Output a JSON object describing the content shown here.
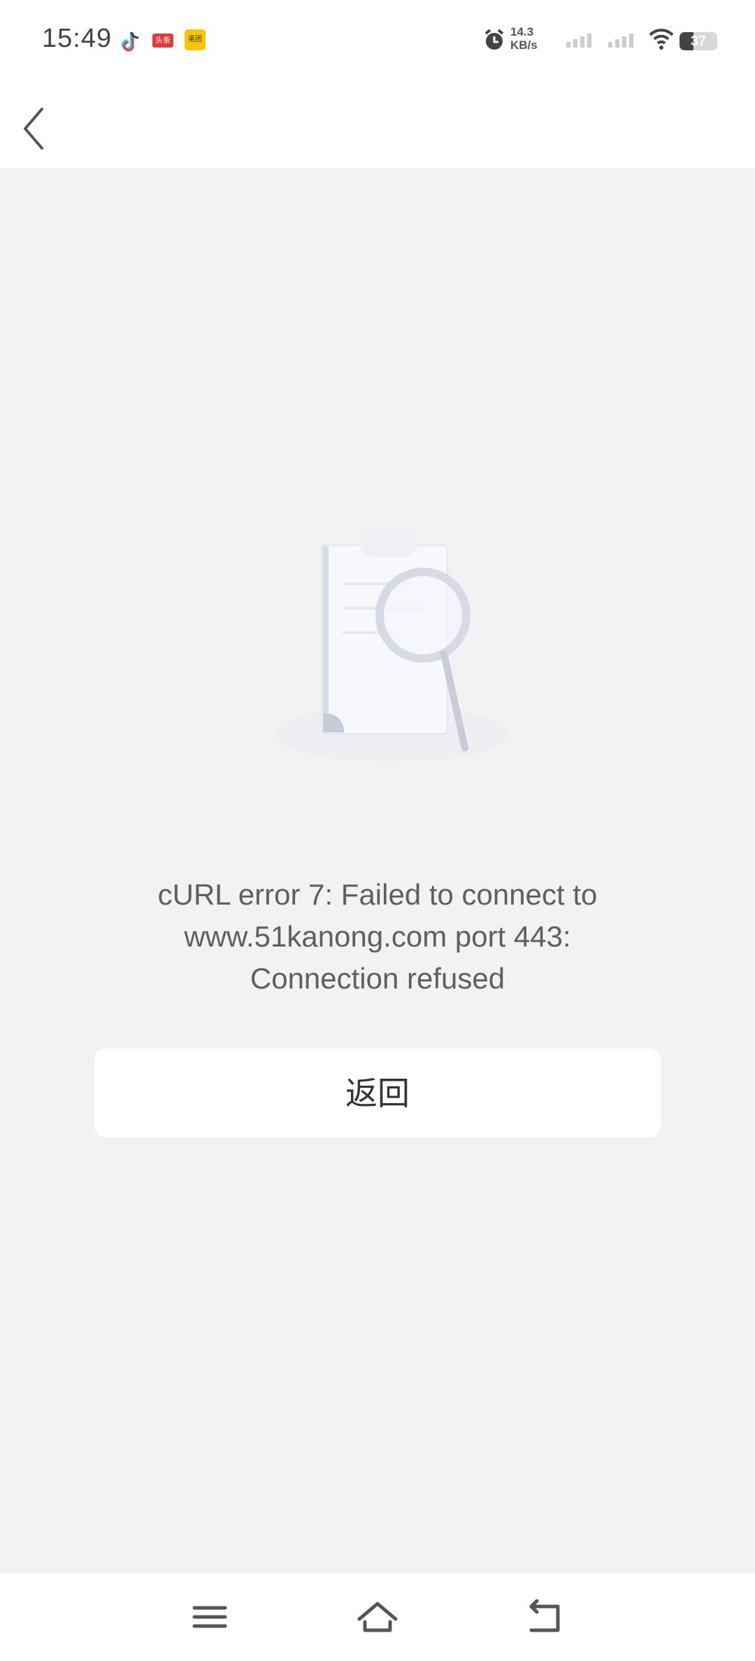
{
  "status_bar": {
    "time": "15:49",
    "notifications": [
      "tiktok-icon",
      "toutiao-icon",
      "meituan-icon"
    ],
    "toutiao_label": "头条",
    "meituan_label": "美团",
    "net_speed_value": "14.3",
    "net_speed_unit": "KB/s",
    "battery_level": "37",
    "icons": [
      "alarm-icon",
      "signal-icon",
      "signal-icon",
      "wifi-icon",
      "battery-icon"
    ]
  },
  "header": {
    "back_icon": "chevron-left-icon"
  },
  "illustration": {
    "icon": "document-search-icon"
  },
  "error": {
    "line1": "cURL error 7: Failed to connect to",
    "line2": "www.51kanong.com port 443:",
    "line3": "Connection refused"
  },
  "actions": {
    "return_label": "返回"
  },
  "bottom_nav": {
    "icons": [
      "menu-icon",
      "home-icon",
      "back-icon"
    ]
  },
  "colors": {
    "background": "#f2f2f3",
    "surface": "#ffffff",
    "text": "#5f5f5f"
  }
}
